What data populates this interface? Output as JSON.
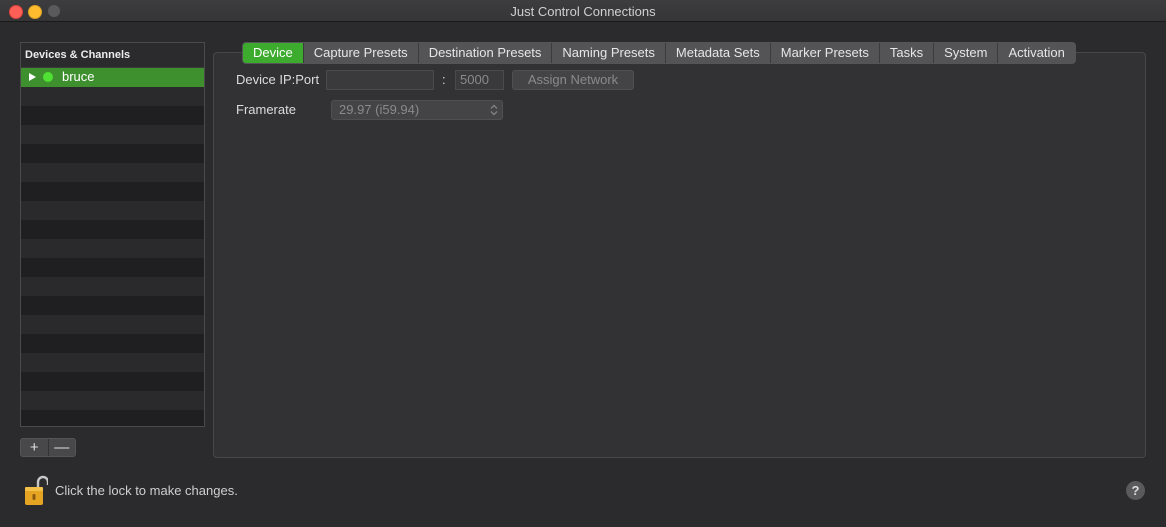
{
  "window": {
    "title": "Just Control Connections"
  },
  "sidebar": {
    "header": "Devices & Channels",
    "devices": [
      {
        "name": "bruce",
        "status_color": "#4fe033"
      }
    ],
    "add_label": "+",
    "remove_label": "—"
  },
  "tabs": [
    {
      "label": "Device",
      "active": true
    },
    {
      "label": "Capture Presets"
    },
    {
      "label": "Destination Presets"
    },
    {
      "label": "Naming Presets"
    },
    {
      "label": "Metadata Sets"
    },
    {
      "label": "Marker Presets"
    },
    {
      "label": "Tasks"
    },
    {
      "label": "System"
    },
    {
      "label": "Activation"
    }
  ],
  "device": {
    "ip_label": "Device IP:Port",
    "ip_value": "",
    "port_separator": ":",
    "port_value": "5000",
    "assign_network_label": "Assign Network",
    "framerate_label": "Framerate",
    "framerate_value": "29.97 (i59.94)"
  },
  "footer": {
    "lock_text": "Click the lock to make changes.",
    "help_label": "?"
  },
  "colors": {
    "accent_green": "#3cab2e",
    "selected_row": "#3e8f2e",
    "background": "#2b2b2d"
  },
  "icons": {
    "lock": "lock-open-icon",
    "help": "help-icon",
    "disclosure": "disclosure-triangle-icon"
  }
}
